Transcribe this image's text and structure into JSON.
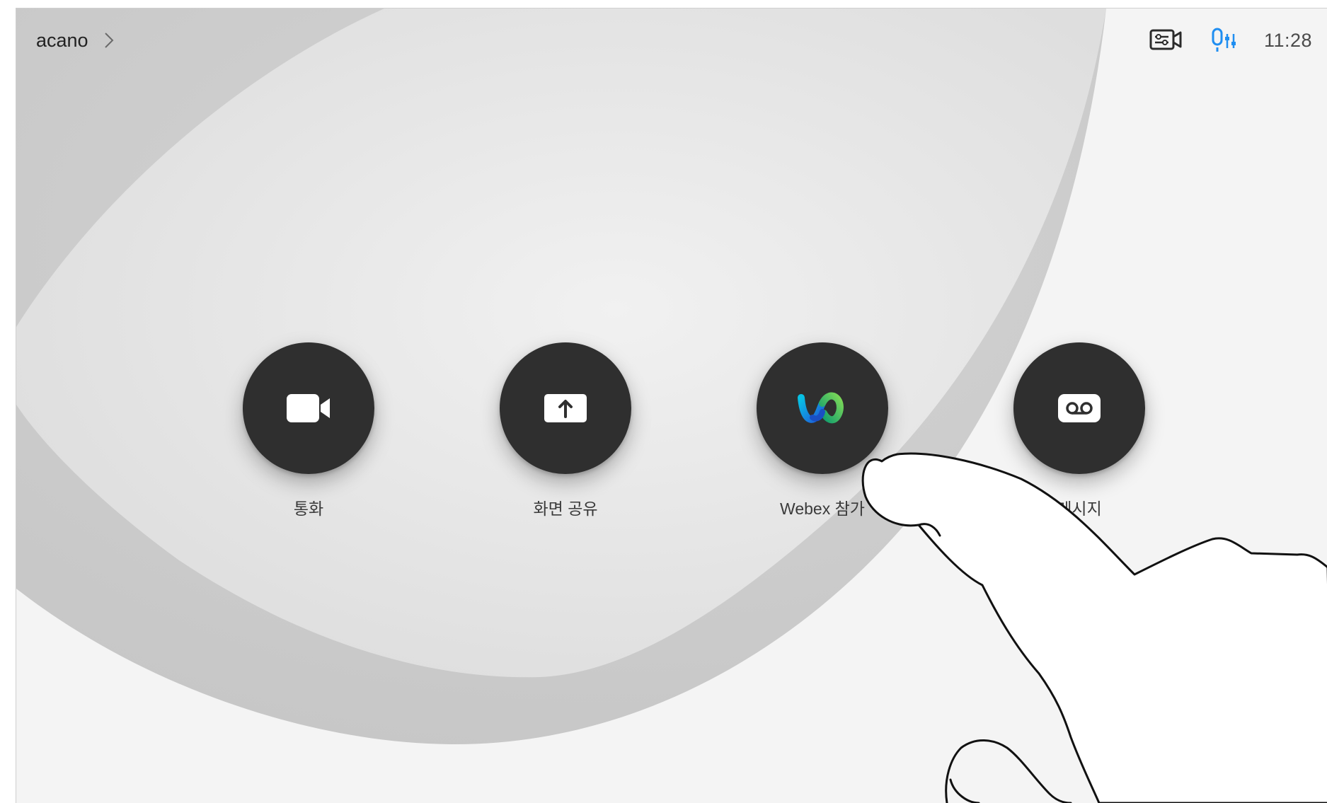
{
  "topbar": {
    "room_name": "acano",
    "room_chevron_icon": "chevron-right-icon",
    "camera_status_icon": "camera-controls-icon",
    "mic_status_icon": "microphone-controls-icon",
    "time": "11:28"
  },
  "actions": [
    {
      "label": "통화",
      "icon": "video-camera-icon"
    },
    {
      "label": "화면 공유",
      "icon": "share-screen-icon"
    },
    {
      "label": "Webex 참가",
      "icon": "webex-logo-icon"
    },
    {
      "label": "메시지",
      "icon": "voicemail-icon"
    }
  ],
  "colors": {
    "accent_blue": "#1f8ef1",
    "button_dark": "#2f2f2f",
    "background": "#ececec"
  }
}
